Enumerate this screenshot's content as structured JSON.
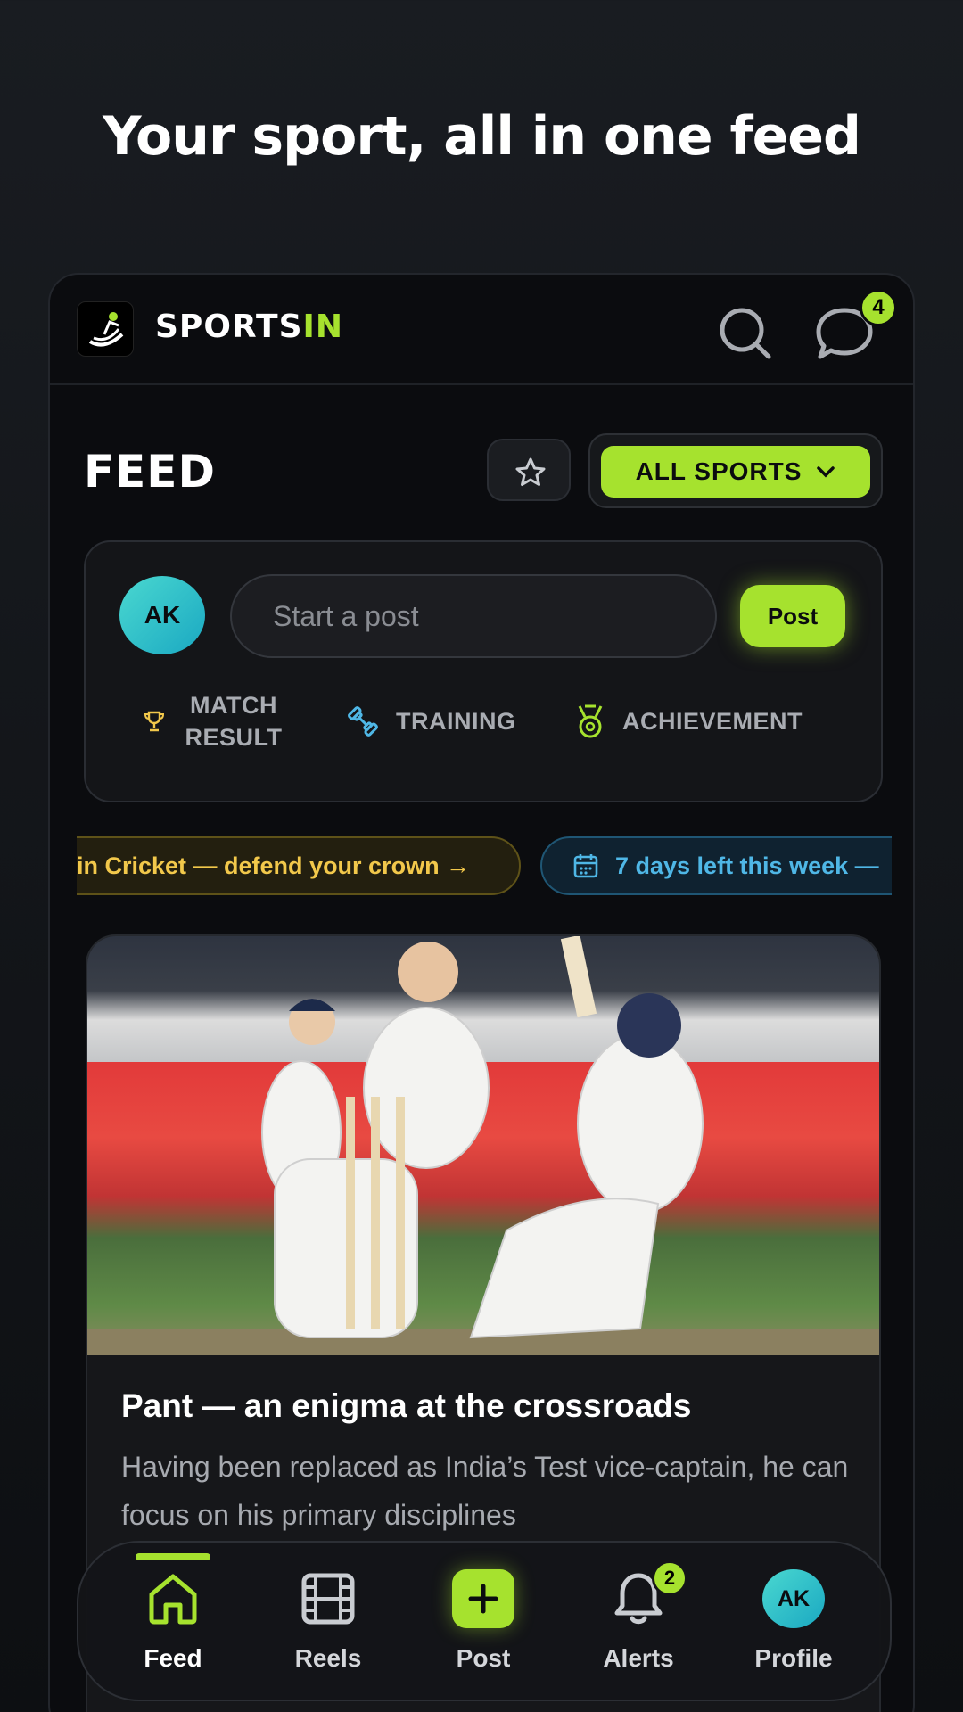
{
  "headline": "Your sport, all in one feed",
  "app": {
    "brand_main": "SPORTS",
    "brand_accent": "IN",
    "chat_badge": "4"
  },
  "feed": {
    "title": "FEED",
    "sports_filter": "ALL SPORTS"
  },
  "composer": {
    "avatar_initials": "AK",
    "placeholder": "Start a post",
    "post_button": "Post",
    "categories": [
      {
        "label": "MATCH RESULT",
        "icon": "trophy-icon"
      },
      {
        "label": "TRAINING",
        "icon": "dumbbell-icon"
      },
      {
        "label": "ACHIEVEMENT",
        "icon": "medal-icon"
      }
    ]
  },
  "ticker": {
    "items": [
      {
        "text": "in Cricket — defend your crown  →"
      },
      {
        "text": "7 days left this week —",
        "icon": "calendar-icon"
      }
    ]
  },
  "post": {
    "title": "Pant — an enigma at the crossroads",
    "body": "Having been replaced as India’s Test vice-captain, he can focus on his primary disciplines"
  },
  "nav": {
    "items": [
      {
        "label": "Feed",
        "icon": "home-icon"
      },
      {
        "label": "Reels",
        "icon": "film-icon"
      },
      {
        "label": "Post",
        "icon": "plus-icon"
      },
      {
        "label": "Alerts",
        "icon": "bell-icon"
      },
      {
        "label": "Profile",
        "avatar": "AK"
      }
    ],
    "alerts_badge": "2"
  },
  "colors": {
    "accent": "#a6e22e",
    "background": "#0b0c0f",
    "ticker_yellow": "#f2c84b",
    "ticker_blue": "#4fb7e6",
    "avatar": "#2fc0c8"
  }
}
